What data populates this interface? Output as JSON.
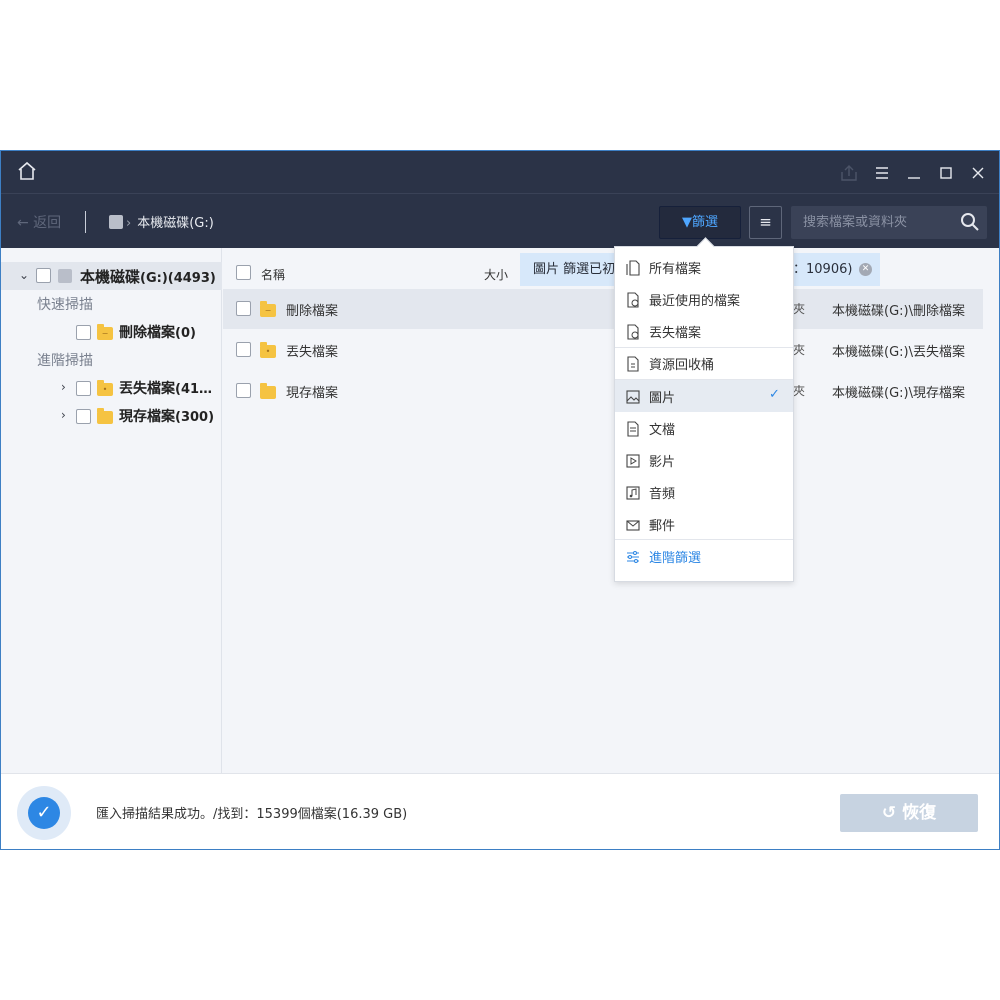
{
  "toolbar": {
    "back_label": "← 返回",
    "drive_crumb": "本機磁碟(G:)",
    "filter_label": "篩選",
    "list_icon": "list-icon",
    "search_placeholder": "搜索檔案或資料夾"
  },
  "sidebar": {
    "root_label": "本機磁碟",
    "root_count": "(G:)(4493)",
    "quick_scan_label": "快速掃描",
    "deleted_label": "刪除檔案",
    "deleted_count": "(0)",
    "advanced_scan_label": "進階掃描",
    "lost_label": "丟失檔案",
    "lost_count": "(41…",
    "existing_label": "現存檔案",
    "existing_count": "(300)"
  },
  "table": {
    "col_name": "名稱",
    "col_size": "大小",
    "banner_left": "圖片 篩選已初",
    "banner_right": "：10906)",
    "rows": [
      {
        "name": "刪除檔案",
        "trunc": "夾",
        "path": "本機磁碟(G:)\\刪除檔案"
      },
      {
        "name": "丟失檔案",
        "trunc": "夾",
        "path": "本機磁碟(G:)\\丟失檔案"
      },
      {
        "name": "現存檔案",
        "trunc": "夾",
        "path": "本機磁碟(G:)\\現存檔案"
      }
    ]
  },
  "filter_menu": {
    "items": [
      {
        "label": "所有檔案",
        "icon": "all-files-icon"
      },
      {
        "label": "最近使用的檔案",
        "icon": "recent-files-icon"
      },
      {
        "label": "丟失檔案",
        "icon": "lost-files-icon"
      },
      {
        "label": "資源回收桶",
        "icon": "recycle-bin-icon"
      },
      {
        "label": "圖片",
        "icon": "image-icon",
        "selected": true
      },
      {
        "label": "文檔",
        "icon": "document-icon"
      },
      {
        "label": "影片",
        "icon": "video-icon"
      },
      {
        "label": "音頻",
        "icon": "audio-icon"
      },
      {
        "label": "郵件",
        "icon": "mail-icon"
      }
    ],
    "checkmark": "✓",
    "advanced_label": "進階篩選"
  },
  "footer": {
    "status": "匯入掃描結果成功。/找到：15399個檔案(16.39 GB)",
    "recover_label": "恢復"
  },
  "colors": {
    "titlebar_bg": "#2b3347",
    "accent": "#2d87e4",
    "folder": "#f5c342"
  }
}
